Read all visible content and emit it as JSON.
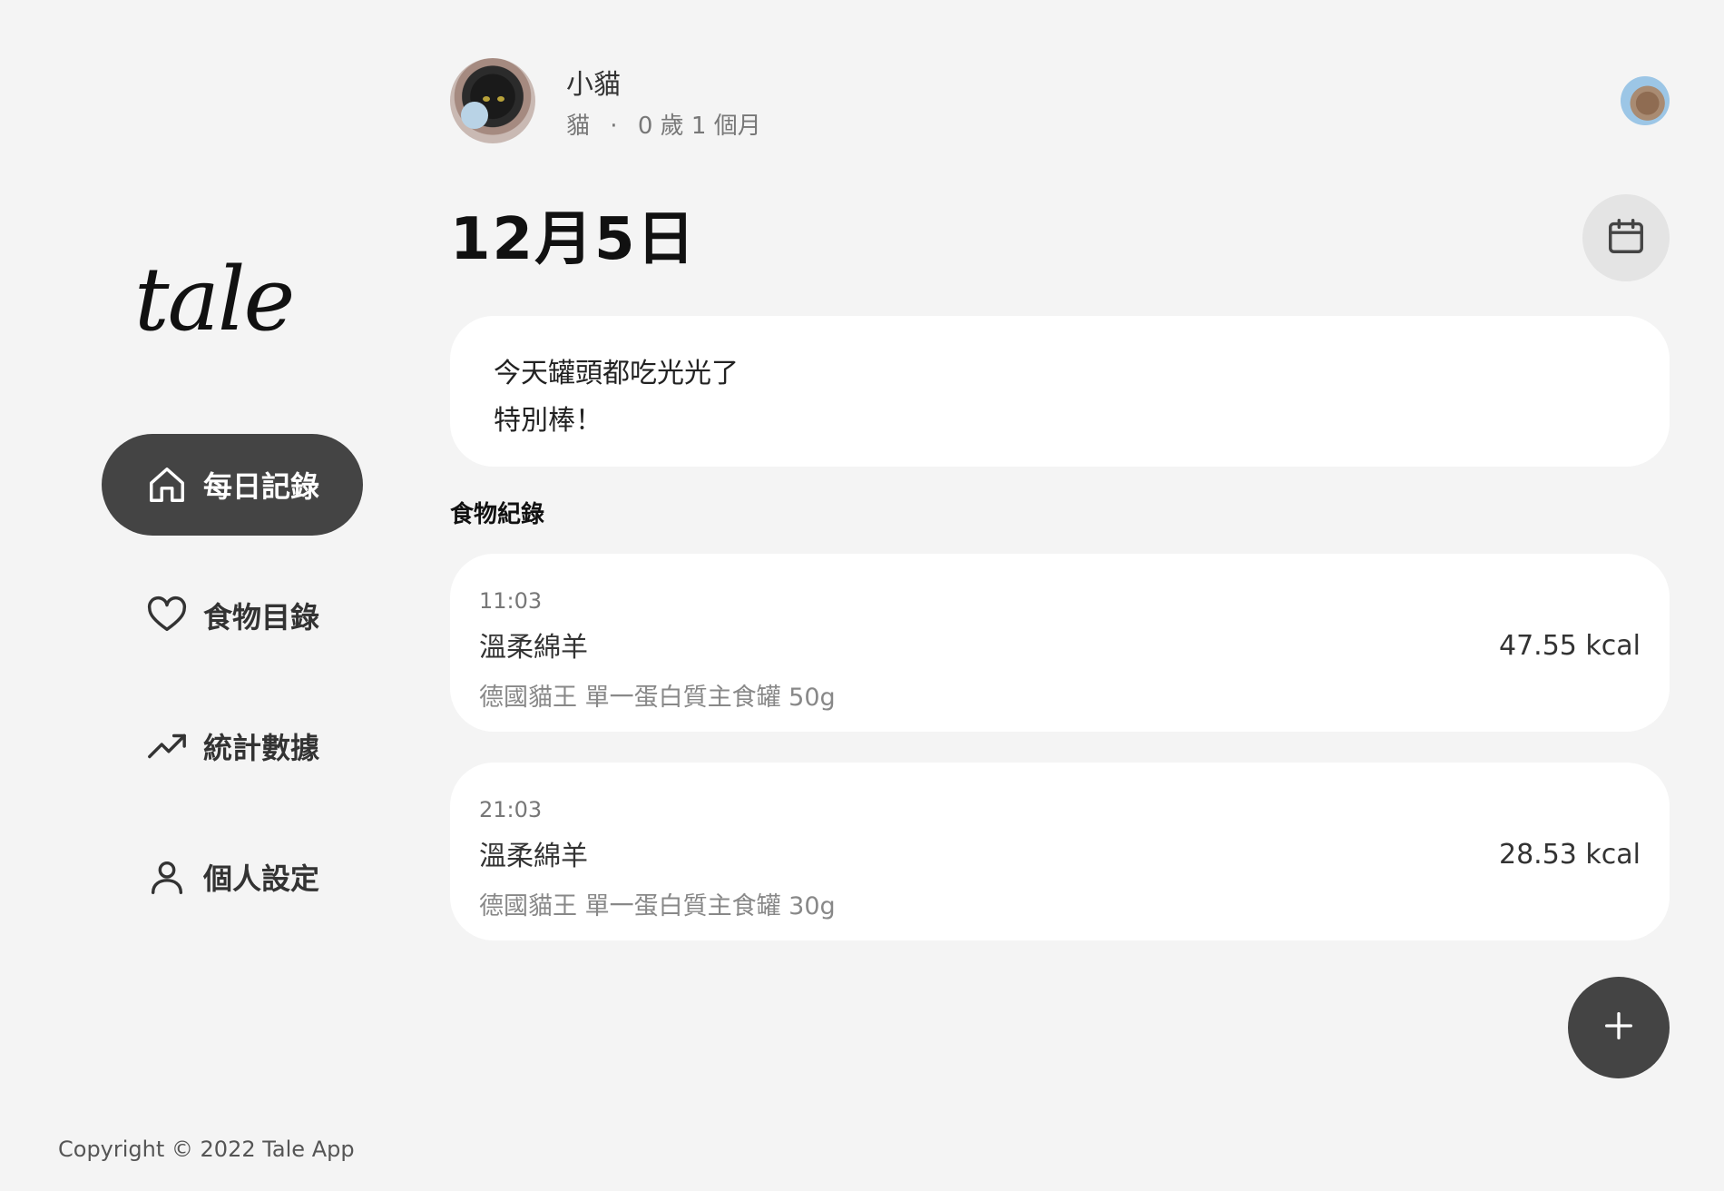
{
  "app": {
    "logo": "tale",
    "copyright": "Copyright © 2022 Tale App"
  },
  "sidebar": {
    "items": [
      {
        "label": "每日記錄",
        "icon": "home-icon",
        "active": true
      },
      {
        "label": "食物目錄",
        "icon": "heart-icon",
        "active": false
      },
      {
        "label": "統計數據",
        "icon": "trending-up-icon",
        "active": false
      },
      {
        "label": "個人設定",
        "icon": "user-icon",
        "active": false
      }
    ]
  },
  "pet": {
    "name": "小貓",
    "species": "貓",
    "separator": "·",
    "age": "0 歲 1 個月"
  },
  "day": {
    "title": "12月5日"
  },
  "note": {
    "lines": [
      "今天罐頭都吃光光了",
      "特別棒！"
    ]
  },
  "food_section": {
    "label": "食物紀錄"
  },
  "food_records": [
    {
      "time": "11:03",
      "name": "溫柔綿羊",
      "detail": "德國貓王 單一蛋白質主食罐 50g",
      "kcal": "47.55 kcal"
    },
    {
      "time": "21:03",
      "name": "溫柔綿羊",
      "detail": "德國貓王 單一蛋白質主食罐 30g",
      "kcal": "28.53 kcal"
    }
  ],
  "colors": {
    "background": "#f4f4f4",
    "active_nav": "#444444",
    "card": "#ffffff",
    "fab": "#444444"
  }
}
